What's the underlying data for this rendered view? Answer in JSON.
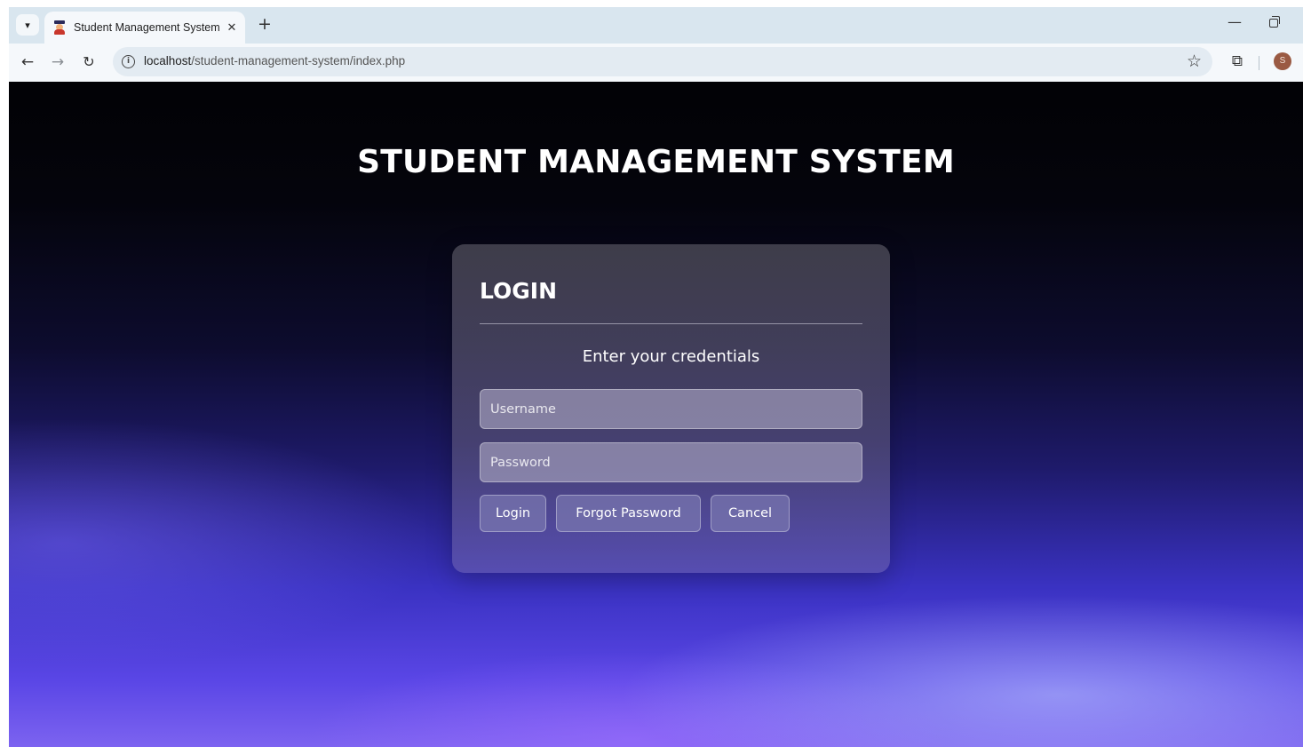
{
  "browser": {
    "tab_menu_icon": "chevron-down-icon",
    "tab": {
      "title": "Student Management System",
      "favicon": "student-icon",
      "close_glyph": "✕"
    },
    "new_tab_glyph": "+",
    "window_controls": {
      "minimize_glyph": "—",
      "restore_icon": "restore-icon"
    },
    "nav": {
      "back_glyph": "←",
      "forward_glyph": "→",
      "reload_glyph": "↻"
    },
    "address_bar": {
      "info_glyph": "i",
      "url_host": "localhost",
      "url_path": "/student-management-system/index.php",
      "bookmark_glyph": "☆"
    },
    "extensions_glyph": "⧉",
    "profile_initial": "S",
    "profile_color": "#9a5a43"
  },
  "page": {
    "title": "STUDENT MANAGEMENT SYSTEM",
    "login_card": {
      "heading": "LOGIN",
      "subtitle": "Enter your credentials",
      "username": {
        "value": "",
        "placeholder": "Username"
      },
      "password": {
        "value": "",
        "placeholder": "Password"
      },
      "buttons": {
        "login": "Login",
        "forgot_password": "Forgot Password",
        "cancel": "Cancel"
      }
    }
  }
}
